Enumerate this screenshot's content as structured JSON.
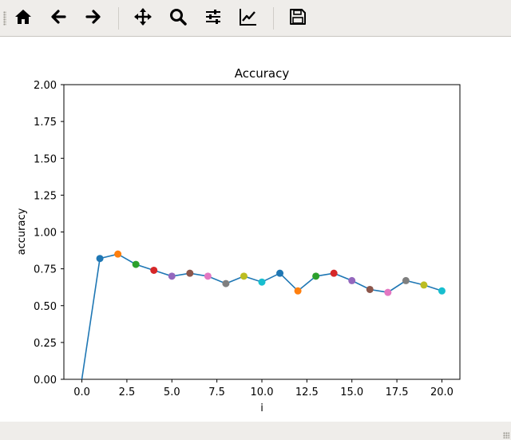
{
  "toolbar": {
    "buttons": [
      {
        "name": "home-button",
        "icon": "home-icon"
      },
      {
        "name": "back-button",
        "icon": "arrow-left-icon"
      },
      {
        "name": "forward-button",
        "icon": "arrow-right-icon"
      },
      {
        "name": "pan-button",
        "icon": "move-icon"
      },
      {
        "name": "zoom-button",
        "icon": "magnifier-icon"
      },
      {
        "name": "configure-subplots-button",
        "icon": "sliders-icon"
      },
      {
        "name": "edit-axis-button",
        "icon": "line-chart-icon"
      },
      {
        "name": "save-button",
        "icon": "floppy-disk-icon"
      }
    ]
  },
  "chart_data": {
    "type": "line",
    "title": "Accuracy",
    "xlabel": "i",
    "ylabel": "accuracy",
    "xlim": [
      -1,
      21
    ],
    "ylim": [
      0,
      2
    ],
    "xticks": [
      0,
      2.5,
      5,
      7.5,
      10,
      12.5,
      15,
      17.5,
      20
    ],
    "xtick_labels": [
      "0.0",
      "2.5",
      "5.0",
      "7.5",
      "10.0",
      "12.5",
      "15.0",
      "17.5",
      "20.0"
    ],
    "yticks": [
      0,
      0.25,
      0.5,
      0.75,
      1.0,
      1.25,
      1.5,
      1.75,
      2.0
    ],
    "ytick_labels": [
      "0.00",
      "0.25",
      "0.50",
      "0.75",
      "1.00",
      "1.25",
      "1.50",
      "1.75",
      "2.00"
    ],
    "grid": false,
    "line_color": "#1f77b4",
    "x": [
      0,
      1,
      2,
      3,
      4,
      5,
      6,
      7,
      8,
      9,
      10,
      11,
      12,
      13,
      14,
      15,
      16,
      17,
      18,
      19,
      20
    ],
    "y": [
      0.0,
      0.82,
      0.85,
      0.78,
      0.74,
      0.7,
      0.72,
      0.7,
      0.65,
      0.7,
      0.66,
      0.72,
      0.6,
      0.7,
      0.72,
      0.67,
      0.61,
      0.59,
      0.67,
      0.64,
      0.6
    ],
    "marker_colors": [
      "#1f77b4",
      "#ff7f0e",
      "#2ca02c",
      "#d62728",
      "#9467bd",
      "#8c564b",
      "#e377c2",
      "#7f7f7f",
      "#bcbd22",
      "#17becf"
    ]
  }
}
